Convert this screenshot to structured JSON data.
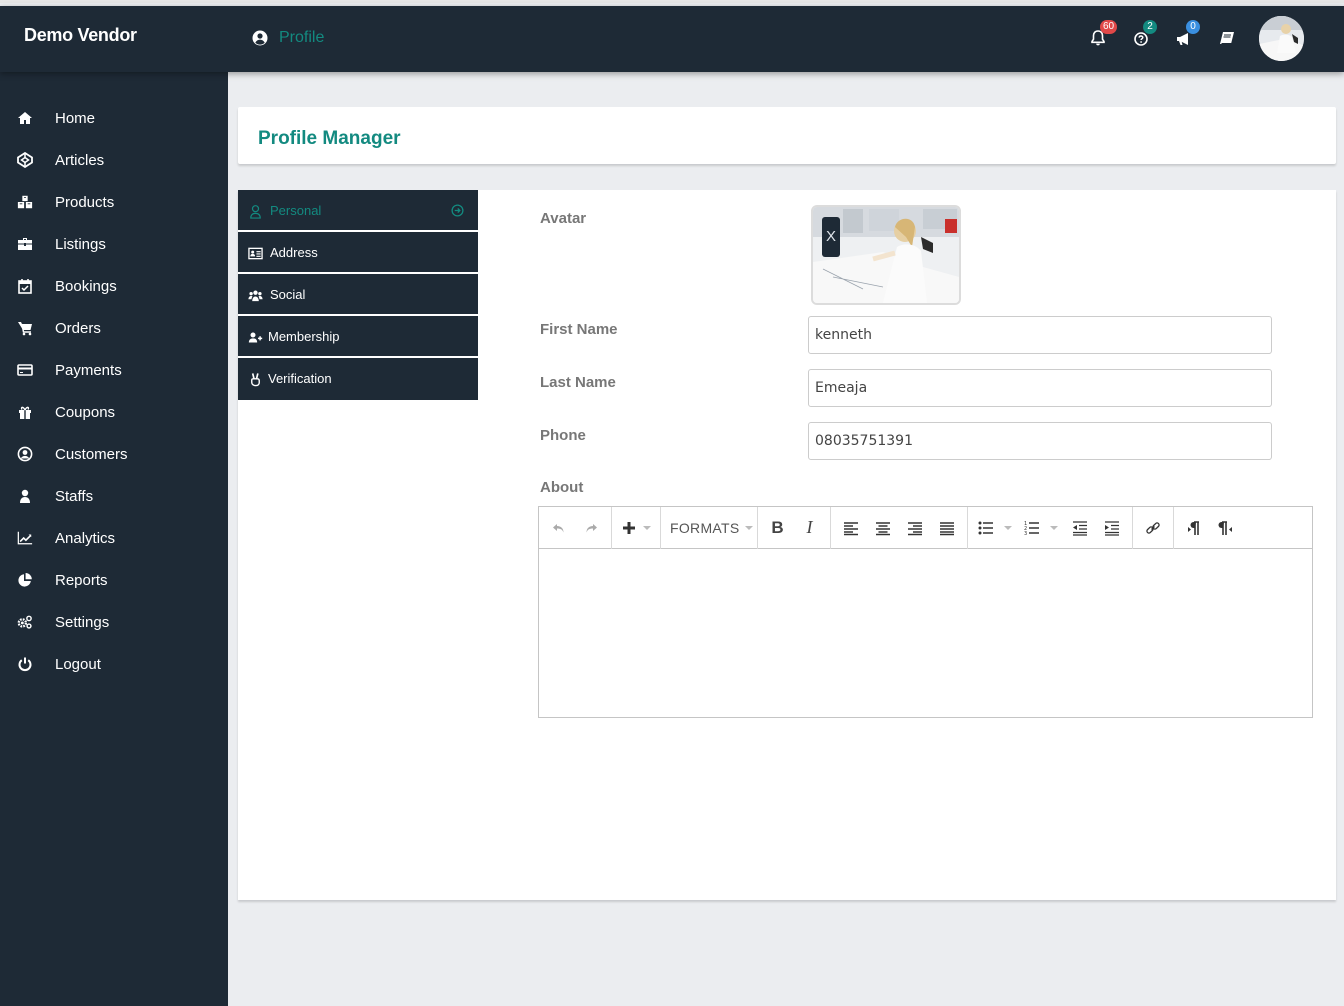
{
  "app": {
    "brand": "Demo Vendor",
    "breadcrumb": "Profile",
    "accent_color": "#138a80",
    "nav_color": "#1e2a36"
  },
  "topbar": {
    "notifications": {
      "icon": "bell-icon",
      "count": "60",
      "color": "#e04848"
    },
    "help": {
      "icon": "question-circle-icon",
      "count": "2",
      "color": "#138a80"
    },
    "announcements": {
      "icon": "bullhorn-icon",
      "count": "0",
      "color": "#3a8fe0"
    },
    "docs": {
      "icon": "book-icon"
    },
    "user_avatar": "user-avatar"
  },
  "sidebar": {
    "items": [
      {
        "label": "Home",
        "icon": "home-icon"
      },
      {
        "label": "Articles",
        "icon": "codepen-icon"
      },
      {
        "label": "Products",
        "icon": "cubes-icon"
      },
      {
        "label": "Listings",
        "icon": "briefcase-icon"
      },
      {
        "label": "Bookings",
        "icon": "calendar-check-icon"
      },
      {
        "label": "Orders",
        "icon": "cart-icon"
      },
      {
        "label": "Payments",
        "icon": "credit-card-icon"
      },
      {
        "label": "Coupons",
        "icon": "gift-icon"
      },
      {
        "label": "Customers",
        "icon": "user-circle-icon"
      },
      {
        "label": "Staffs",
        "icon": "user-icon"
      },
      {
        "label": "Analytics",
        "icon": "line-chart-icon"
      },
      {
        "label": "Reports",
        "icon": "pie-chart-icon"
      },
      {
        "label": "Settings",
        "icon": "cogs-icon"
      },
      {
        "label": "Logout",
        "icon": "power-icon"
      }
    ]
  },
  "page": {
    "title": "Profile Manager",
    "tabs": [
      {
        "label": "Personal",
        "icon": "user-outline-icon",
        "active": true
      },
      {
        "label": "Address",
        "icon": "id-card-icon",
        "active": false
      },
      {
        "label": "Social",
        "icon": "users-icon",
        "active": false
      },
      {
        "label": "Membership",
        "icon": "user-plus-icon",
        "active": false
      },
      {
        "label": "Verification",
        "icon": "hand-peace-icon",
        "active": false
      }
    ],
    "form": {
      "avatar_label": "Avatar",
      "avatar_remove": "X",
      "first_name_label": "First Name",
      "first_name_value": "kenneth",
      "last_name_label": "Last Name",
      "last_name_value": "Emeaja",
      "phone_label": "Phone",
      "phone_value": "08035751391",
      "about_label": "About",
      "about_value": ""
    },
    "editor": {
      "formats_label": "FORMATS",
      "bold": "B",
      "italic": "I"
    }
  }
}
